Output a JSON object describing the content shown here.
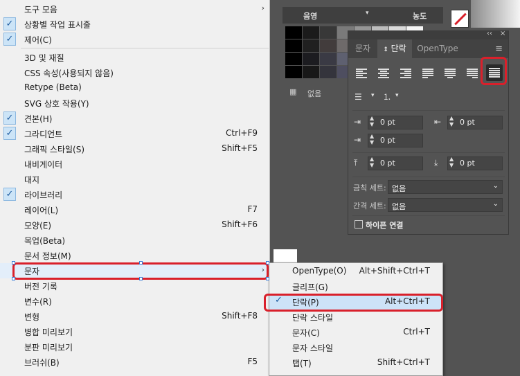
{
  "window_menu": {
    "items": [
      {
        "label": "도구 모음",
        "shortcut": "",
        "checked": false,
        "submenu": true
      },
      {
        "label": "상황별 작업 표시줄",
        "shortcut": "",
        "checked": true,
        "submenu": false
      },
      {
        "label": "제어(C)",
        "shortcut": "",
        "checked": true,
        "submenu": false
      },
      {
        "label": "3D 및 재질",
        "shortcut": "",
        "checked": false,
        "submenu": false
      },
      {
        "label": "CSS 속성(사용되지 않음)",
        "shortcut": "",
        "checked": false,
        "submenu": false
      },
      {
        "label": "Retype (Beta)",
        "shortcut": "",
        "checked": false,
        "submenu": false
      },
      {
        "label": "SVG 상호 작용(Y)",
        "shortcut": "",
        "checked": false,
        "submenu": false
      },
      {
        "label": "견본(H)",
        "shortcut": "",
        "checked": true,
        "submenu": false
      },
      {
        "label": "그라디언트",
        "shortcut": "Ctrl+F9",
        "checked": true,
        "submenu": false
      },
      {
        "label": "그래픽 스타일(S)",
        "shortcut": "Shift+F5",
        "checked": false,
        "submenu": false
      },
      {
        "label": "내비게이터",
        "shortcut": "",
        "checked": false,
        "submenu": false
      },
      {
        "label": "대지",
        "shortcut": "",
        "checked": false,
        "submenu": false
      },
      {
        "label": "라이브러리",
        "shortcut": "",
        "checked": true,
        "submenu": false
      },
      {
        "label": "레이어(L)",
        "shortcut": "F7",
        "checked": false,
        "submenu": false
      },
      {
        "label": "모양(E)",
        "shortcut": "Shift+F6",
        "checked": false,
        "submenu": false
      },
      {
        "label": "목업(Beta)",
        "shortcut": "",
        "checked": false,
        "submenu": false
      },
      {
        "label": "문서 정보(M)",
        "shortcut": "",
        "checked": false,
        "submenu": false
      },
      {
        "label": "문자",
        "shortcut": "",
        "checked": false,
        "submenu": true
      },
      {
        "label": "버전 기록",
        "shortcut": "",
        "checked": false,
        "submenu": false
      },
      {
        "label": "변수(R)",
        "shortcut": "",
        "checked": false,
        "submenu": false
      },
      {
        "label": "변형",
        "shortcut": "Shift+F8",
        "checked": false,
        "submenu": false
      },
      {
        "label": "병합 미리보기",
        "shortcut": "",
        "checked": false,
        "submenu": false
      },
      {
        "label": "분판 미리보기",
        "shortcut": "",
        "checked": false,
        "submenu": false
      },
      {
        "label": "브러쉬(B)",
        "shortcut": "F5",
        "checked": false,
        "submenu": false
      }
    ],
    "check_glyph": "✓",
    "arrow_glyph": "›"
  },
  "swatches": {
    "col_left": "음영",
    "col_right": "농도",
    "footer_none": "없음"
  },
  "paragraph_panel": {
    "collapse_glyph": "‹‹",
    "close_glyph": "×",
    "tabs": [
      "문자",
      "단락",
      "OpenType"
    ],
    "active_tab": "단락",
    "menu_glyph": "≡",
    "alignment_buttons": [
      "왼쪽 정렬",
      "가운데 정렬",
      "오른쪽 정렬",
      "마지막 줄 왼쪽 정렬",
      "마지막 줄 가운데 정렬",
      "마지막 줄 오른쪽 정렬",
      "강제 정렬"
    ],
    "selected_alignment": "강제 정렬",
    "fields": {
      "left_indent": "0 pt",
      "right_indent": "0 pt",
      "first_line_indent": "0 pt",
      "space_before": "0 pt",
      "space_after": "0 pt"
    },
    "kinsoku_label": "금칙 세트:",
    "kinsoku_value": "없음",
    "mojikumi_label": "간격 세트:",
    "mojikumi_value": "없음",
    "hyphenate_label": "하이픈 연결",
    "hyphenate_checked": false
  },
  "type_submenu": {
    "items": [
      {
        "label": "OpenType(O)",
        "shortcut": "Alt+Shift+Ctrl+T",
        "checked": false
      },
      {
        "label": "글리프(G)",
        "shortcut": "",
        "checked": false
      },
      {
        "label": "단락(P)",
        "shortcut": "Alt+Ctrl+T",
        "checked": true
      },
      {
        "label": "단락 스타일",
        "shortcut": "",
        "checked": false
      },
      {
        "label": "문자(C)",
        "shortcut": "Ctrl+T",
        "checked": false
      },
      {
        "label": "문자 스타일",
        "shortcut": "",
        "checked": false
      },
      {
        "label": "탭(T)",
        "shortcut": "Shift+Ctrl+T",
        "checked": false
      }
    ]
  },
  "colors": {
    "menu_bg": "#f0f0f0",
    "app_bg": "#535353",
    "highlight_red": "#d9202b",
    "check_blue": "#1c5a9e"
  }
}
